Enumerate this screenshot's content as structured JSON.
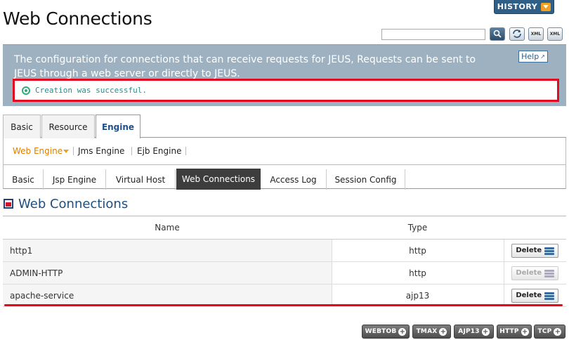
{
  "header": {
    "title": "Web Connections",
    "history_label": "HISTORY",
    "search_placeholder": ""
  },
  "toolbar": {
    "icons": [
      "search-icon",
      "refresh-icon",
      "xml-import-icon",
      "xml-export-icon"
    ],
    "xml_label": "XML"
  },
  "info": {
    "description": "The configuration for connections that can receive requests for JEUS, Requests can be sent to JEUS through a web server or directly to JEUS.",
    "help_label": "Help",
    "message": "Creation was successful."
  },
  "main_tabs": [
    {
      "label": "Basic",
      "active": false
    },
    {
      "label": "Resource",
      "active": false
    },
    {
      "label": "Engine",
      "active": true
    }
  ],
  "engine_tabs": [
    {
      "label": "Web Engine",
      "active": true
    },
    {
      "label": "Jms Engine",
      "active": false
    },
    {
      "label": "Ejb Engine",
      "active": false
    }
  ],
  "web_tabs": [
    {
      "label": "Basic",
      "active": false
    },
    {
      "label": "Jsp Engine",
      "active": false
    },
    {
      "label": "Virtual Host",
      "active": false
    },
    {
      "label": "Web Connections",
      "active": true
    },
    {
      "label": "Access Log",
      "active": false
    },
    {
      "label": "Session Config",
      "active": false
    }
  ],
  "section": {
    "title": "Web Connections"
  },
  "table": {
    "columns": [
      "Name",
      "Type"
    ],
    "rows": [
      {
        "name": "http1",
        "type": "http",
        "delete_label": "Delete",
        "delete_enabled": true
      },
      {
        "name": "ADMIN-HTTP",
        "type": "http",
        "delete_label": "Delete",
        "delete_enabled": false
      },
      {
        "name": "apache-service",
        "type": "ajp13",
        "delete_label": "Delete",
        "delete_enabled": true
      }
    ]
  },
  "add_buttons": [
    {
      "label": "WEBTOB"
    },
    {
      "label": "TMAX"
    },
    {
      "label": "AJP13"
    },
    {
      "label": "HTTP"
    },
    {
      "label": "TCP"
    }
  ],
  "colors": {
    "highlight": "#e30a1f",
    "panel": "#9eb1c1",
    "active_tab": "#3d3d3d",
    "accent": "#e07f00"
  }
}
